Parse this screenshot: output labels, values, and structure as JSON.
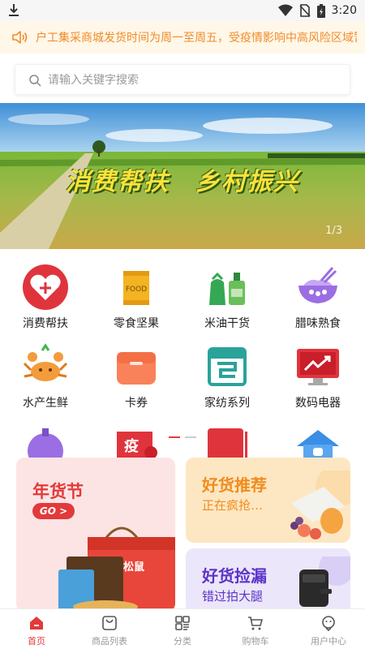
{
  "status_bar": {
    "time": "3:20",
    "icons": [
      "download-icon",
      "wifi-icon",
      "no-sim-icon",
      "battery-icon"
    ]
  },
  "notice": {
    "text": "户工集采商城发货时间为周一至周五，受疫情影响中高风险区域暂",
    "icon": "speaker-icon"
  },
  "search": {
    "placeholder": "请输入关键字搜索",
    "value": ""
  },
  "banner": {
    "slogan": "消费帮扶　乡村振兴",
    "pager": "1/3"
  },
  "categories": [
    {
      "label": "消费帮扶",
      "icon": "heart-plus-icon"
    },
    {
      "label": "零食坚果",
      "icon": "snack-bag-icon"
    },
    {
      "label": "米油干货",
      "icon": "rice-oil-icon"
    },
    {
      "label": "腊味熟食",
      "icon": "noodle-bowl-icon"
    },
    {
      "label": "水产生鲜",
      "icon": "crab-icon"
    },
    {
      "label": "卡券",
      "icon": "wallet-icon"
    },
    {
      "label": "家纺系列",
      "icon": "towel-icon"
    },
    {
      "label": "数码电器",
      "icon": "monitor-icon"
    }
  ],
  "promo": {
    "festival": {
      "title": "年货节",
      "go": "GO >",
      "brand": "松鼠"
    },
    "recommend": {
      "title": "好货推荐",
      "sub": "正在疯抢…"
    },
    "bargain": {
      "title": "好货捡漏",
      "sub": "错过拍大腿"
    }
  },
  "bottom_nav": [
    {
      "label": "首页",
      "icon": "home-icon",
      "active": true
    },
    {
      "label": "商品列表",
      "icon": "product-list-icon",
      "active": false
    },
    {
      "label": "分类",
      "icon": "category-icon",
      "active": false
    },
    {
      "label": "购物车",
      "icon": "cart-icon",
      "active": false
    },
    {
      "label": "用户中心",
      "icon": "user-center-icon",
      "active": false
    }
  ],
  "colors": {
    "accent": "#e23a3a",
    "notice_bg": "#fff7e8",
    "notice_text": "#f08c2a"
  }
}
